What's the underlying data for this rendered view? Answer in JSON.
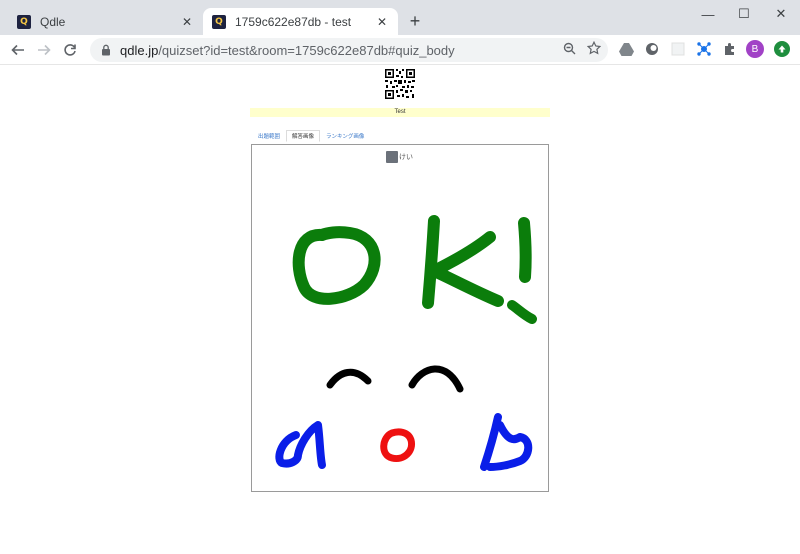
{
  "browser": {
    "tabs": [
      {
        "title": "Qdle",
        "favicon": "Q",
        "active": false
      },
      {
        "title": "1759c622e87db - test",
        "favicon": "Q",
        "active": true
      }
    ],
    "new_tab": "+",
    "url_host": "qdle.jp",
    "url_path": "/quizset?id=test&room=1759c622e87db#quiz_body",
    "profile_initial": "B",
    "window_controls": {
      "minimize": "—",
      "maximize": "☐",
      "close": "✕"
    }
  },
  "page": {
    "room_title": "Test",
    "tabs": [
      {
        "label": "出題範囲",
        "active": false
      },
      {
        "label": "解答画像",
        "active": true
      },
      {
        "label": "ランキング画像",
        "active": false
      }
    ],
    "user_name": "けい"
  },
  "colors": {
    "tabstrip": "#dee1e6",
    "room_bar": "#ffffcc",
    "drawing_green": "#0b7d0b",
    "drawing_black": "#000000",
    "drawing_red": "#ee1111",
    "drawing_blue": "#0a1ee8",
    "profile_purple": "#a142c6",
    "ext_green": "#1e8e3e"
  }
}
